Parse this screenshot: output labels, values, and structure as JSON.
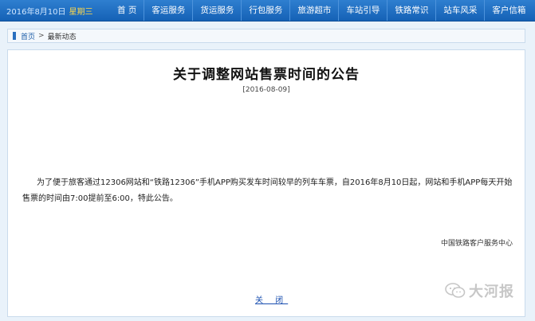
{
  "header": {
    "date": "2016年8月10日",
    "weekday": "星期三",
    "nav": [
      "首 页",
      "客运服务",
      "货运服务",
      "行包服务",
      "旅游超市",
      "车站引导",
      "铁路常识",
      "站车风采",
      "客户信箱"
    ]
  },
  "breadcrumb": {
    "home": "首页",
    "separator": ">",
    "current": "最新动态"
  },
  "article": {
    "title": "关于调整网站售票时间的公告",
    "date": "[2016-08-09]",
    "body": "为了便于旅客通过12306网站和“铁路12306”手机APP购买发车时间较早的列车车票，自2016年8月10日起，网站和手机APP每天开始售票的时间由7:00提前至6:00，特此公告。",
    "signature": "中国铁路客户服务中心",
    "close_label": "关 闭"
  },
  "watermark": {
    "text": "大河报",
    "icon": "wechat-icon"
  }
}
